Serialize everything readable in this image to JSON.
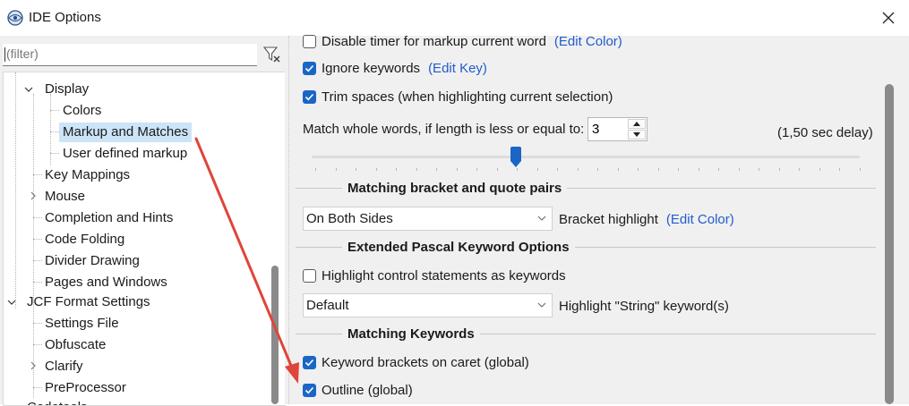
{
  "window": {
    "title": "IDE Options",
    "close_glyph": "✕"
  },
  "colors": {
    "accent": "#1a66c6",
    "link": "#1f5ccc",
    "selection": "#cce4f7",
    "annotation_arrow": "#e0453a"
  },
  "filter": {
    "placeholder": "(filter)",
    "clear_icon": "filter-clear-icon"
  },
  "tree": {
    "items": [
      {
        "label": "Display",
        "expander": "expanded"
      },
      {
        "label": "Colors"
      },
      {
        "label": "Markup and Matches",
        "selected": true
      },
      {
        "label": "User defined markup"
      },
      {
        "label": "Key Mappings"
      },
      {
        "label": "Mouse",
        "expander": "collapsed"
      },
      {
        "label": "Completion and Hints"
      },
      {
        "label": "Code Folding"
      },
      {
        "label": "Divider Drawing"
      },
      {
        "label": "Pages and Windows"
      },
      {
        "label": "JCF Format Settings",
        "expander": "expanded"
      },
      {
        "label": "Settings File"
      },
      {
        "label": "Obfuscate"
      },
      {
        "label": "Clarify",
        "expander": "collapsed"
      },
      {
        "label": "PreProcessor"
      },
      {
        "label": "Codetools"
      }
    ]
  },
  "options": {
    "disable_timer": {
      "label": "Disable timer for markup current word",
      "checked": false,
      "link": "(Edit Color)"
    },
    "ignore_keywords": {
      "label": "Ignore keywords",
      "checked": true,
      "link": "(Edit Key)"
    },
    "trim_spaces": {
      "label": "Trim spaces (when highlighting current selection)",
      "checked": true
    },
    "match_whole_words": {
      "label": "Match whole words, if length is less or equal to:",
      "value": "3"
    },
    "delay_label": "(1,50 sec delay)",
    "delay_slider_value": 1.5
  },
  "groups": {
    "bracket": {
      "title": "Matching bracket and quote pairs",
      "combo_value": "On Both Sides",
      "label": "Bracket highlight",
      "link": "(Edit Color)"
    },
    "pascal": {
      "title": "Extended Pascal Keyword Options",
      "highlight_control": {
        "label": "Highlight control statements as keywords",
        "checked": false
      },
      "combo_value": "Default",
      "string_label": "Highlight \"String\" keyword(s)"
    },
    "keywords": {
      "title": "Matching Keywords",
      "keyword_brackets": {
        "label": "Keyword brackets on caret (global)",
        "checked": true
      },
      "outline": {
        "label": "Outline (global)",
        "checked": true
      }
    }
  }
}
